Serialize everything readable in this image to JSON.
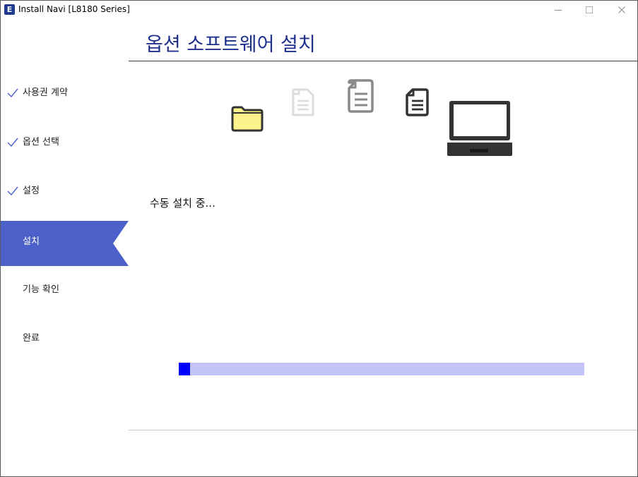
{
  "window": {
    "title": "Install Navi [L8180 Series]",
    "app_icon_letter": "E",
    "controls": {
      "minimize_icon": "minimize-icon",
      "maximize_icon": "maximize-icon",
      "close_icon": "close-icon"
    }
  },
  "header": {
    "title": "옵션 소프트웨어 설치"
  },
  "sidebar": {
    "items": [
      {
        "label": "사용권 계약",
        "completed": true,
        "active": false
      },
      {
        "label": "옵션 선택",
        "completed": true,
        "active": false
      },
      {
        "label": "설정",
        "completed": true,
        "active": false
      },
      {
        "label": "설치",
        "completed": false,
        "active": true
      },
      {
        "label": "기능 확인",
        "completed": false,
        "active": false
      },
      {
        "label": "완료",
        "completed": false,
        "active": false
      }
    ]
  },
  "animation": {
    "icons": [
      "folder-icon",
      "document-icon",
      "document-icon",
      "document-icon",
      "laptop-icon"
    ],
    "colors": {
      "folder_fill": "#fdf28c",
      "outline_dark": "#333333",
      "outline_mid": "#8a8a8a",
      "outline_faded": "#dcdcdc"
    }
  },
  "status": {
    "text": "수동 설치 중..."
  },
  "progress": {
    "fraction": 0.028,
    "track_color": "#c3c3f7",
    "fill_color": "#0000ff"
  },
  "colors": {
    "accent": "#4b60c8",
    "title": "#1f2f8c"
  }
}
